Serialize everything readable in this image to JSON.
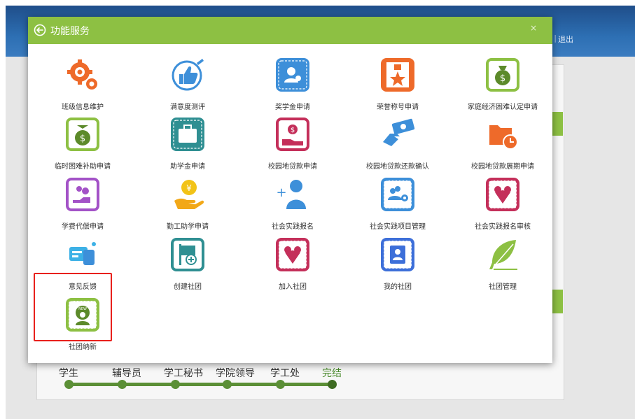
{
  "header": {
    "logout_label": "退出",
    "separator": "|"
  },
  "flow": {
    "steps": [
      "学生",
      "辅导员",
      "学工秘书",
      "学院领导",
      "学工处",
      "完结"
    ]
  },
  "modal": {
    "title": "功能服务",
    "close_label": "×",
    "tiles": [
      {
        "label": "班级信息维护",
        "icon": "gears-icon"
      },
      {
        "label": "满意度测评",
        "icon": "thumbs-up-icon"
      },
      {
        "label": "奖学金申请",
        "icon": "scholarship-icon"
      },
      {
        "label": "荣誉称号申请",
        "icon": "honor-medal-icon"
      },
      {
        "label": "家庭经济困难认定申请",
        "icon": "money-bag-icon"
      },
      {
        "label": "临时困难补助申请",
        "icon": "money-bag-icon"
      },
      {
        "label": "助学金申请",
        "icon": "briefcase-icon"
      },
      {
        "label": "校园地贷款申请",
        "icon": "coin-hand-icon"
      },
      {
        "label": "校园地贷款还款确认",
        "icon": "cash-hand-icon"
      },
      {
        "label": "校园地贷款展期申请",
        "icon": "folder-clock-icon"
      },
      {
        "label": "学费代偿申请",
        "icon": "hand-coins-icon"
      },
      {
        "label": "勤工助学申请",
        "icon": "coin-palm-icon"
      },
      {
        "label": "社会实践报名",
        "icon": "add-user-icon"
      },
      {
        "label": "社会实践项目管理",
        "icon": "team-gear-icon"
      },
      {
        "label": "社会实践报名审核",
        "icon": "club-emblem-icon"
      },
      {
        "label": "意见反馈",
        "icon": "chat-bubbles-icon"
      },
      {
        "label": "创建社团",
        "icon": "flag-add-icon"
      },
      {
        "label": "加入社团",
        "icon": "club-emblem-icon"
      },
      {
        "label": "我的社团",
        "icon": "id-card-icon"
      },
      {
        "label": "社团管理",
        "icon": "feather-icon"
      },
      {
        "label": "社团纳新",
        "icon": "new-member-icon"
      }
    ]
  },
  "colors": {
    "accent_green": "#8dc043",
    "header_blue": "#2d6fb3",
    "highlight_red": "#e8201c",
    "icon_orange": "#ee6a2a",
    "icon_blue": "#3d8fd9",
    "icon_purple": "#a352c7",
    "icon_teal": "#2f8f92",
    "icon_crimson": "#c42f5a"
  }
}
